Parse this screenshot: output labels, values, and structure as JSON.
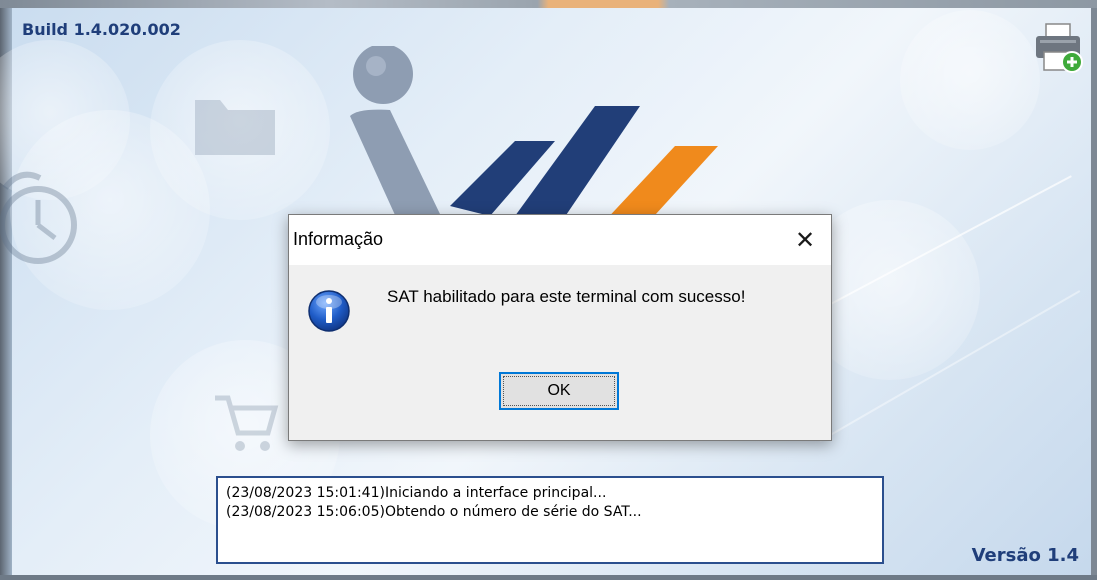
{
  "app": {
    "build": "Build 1.4.020.002",
    "version": "Versão 1.4"
  },
  "icons": {
    "printer": "printer-add-icon",
    "info": "info-icon",
    "close": "close-icon"
  },
  "colors": {
    "brand_blue": "#1f3e7a",
    "logo_orange": "#f08a1c",
    "logo_gray": "#8e9db2",
    "focus_blue": "#0078d7"
  },
  "dialog": {
    "title": "Informação",
    "message": "SAT habilitado para este terminal com sucesso!",
    "ok_label": "OK",
    "close_label": "✕"
  },
  "log": {
    "lines": [
      "(23/08/2023 15:01:41)Iniciando a interface principal...",
      "(23/08/2023 15:06:05)Obtendo o número de série do SAT..."
    ]
  }
}
